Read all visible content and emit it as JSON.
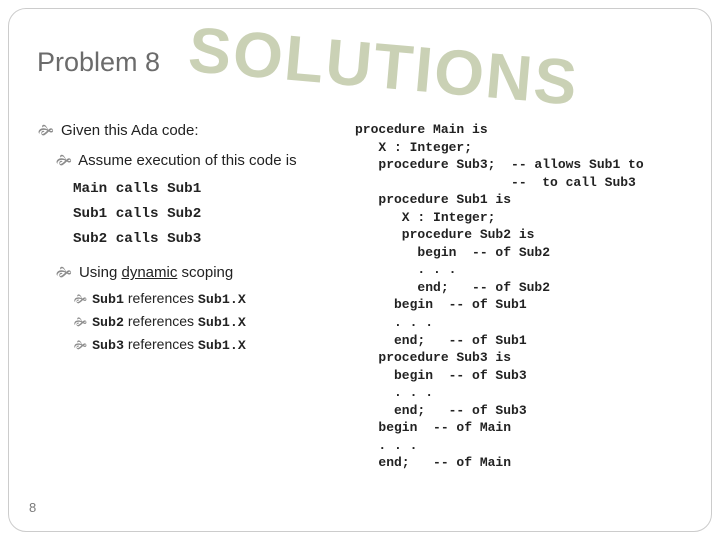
{
  "header": {
    "title": "Problem 8",
    "watermark": "SOLUTIONS"
  },
  "page_number": "8",
  "left": {
    "given": "Given this Ada code:",
    "assume_lead": "Assume execution of this code is",
    "assume_lines": [
      "Main calls Sub1",
      "Sub1 calls Sub2",
      "Sub2 calls Sub3"
    ],
    "scoping_lead_pre": "Using ",
    "scoping_lead_ul": "dynamic",
    "scoping_lead_post": " scoping",
    "refs": [
      {
        "sub": "Sub1",
        "mid": " references ",
        "var": "Sub1.X"
      },
      {
        "sub": "Sub2",
        "mid": " references ",
        "var": "Sub1.X"
      },
      {
        "sub": "Sub3",
        "mid": " references ",
        "var": "Sub1.X"
      }
    ]
  },
  "code": "procedure Main is\n   X : Integer;\n   procedure Sub3;  -- allows Sub1 to\n                    --  to call Sub3\n   procedure Sub1 is\n      X : Integer;\n      procedure Sub2 is\n        begin  -- of Sub2\n        . . .\n        end;   -- of Sub2\n     begin  -- of Sub1\n     . . .\n     end;   -- of Sub1\n   procedure Sub3 is\n     begin  -- of Sub3\n     . . .\n     end;   -- of Sub3\n   begin  -- of Main\n   . . .\n   end;   -- of Main"
}
